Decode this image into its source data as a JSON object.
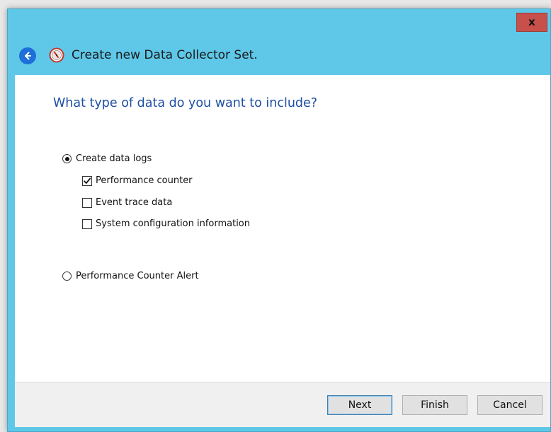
{
  "titlebar": {
    "close_label": "x"
  },
  "header": {
    "title": "Create new Data Collector Set."
  },
  "main": {
    "question": "What type of data do you want to include?",
    "radio_create_logs": {
      "label": "Create data logs",
      "selected": true
    },
    "checkboxes": [
      {
        "label": "Performance counter",
        "checked": true
      },
      {
        "label": "Event trace data",
        "checked": false
      },
      {
        "label": "System configuration information",
        "checked": false
      }
    ],
    "radio_alert": {
      "label": "Performance Counter Alert",
      "selected": false
    }
  },
  "footer": {
    "next_label": "Next",
    "finish_label": "Finish",
    "cancel_label": "Cancel"
  },
  "colors": {
    "frame": "#5fc8e9",
    "close": "#c7504a",
    "question_text": "#1f4fa3"
  }
}
